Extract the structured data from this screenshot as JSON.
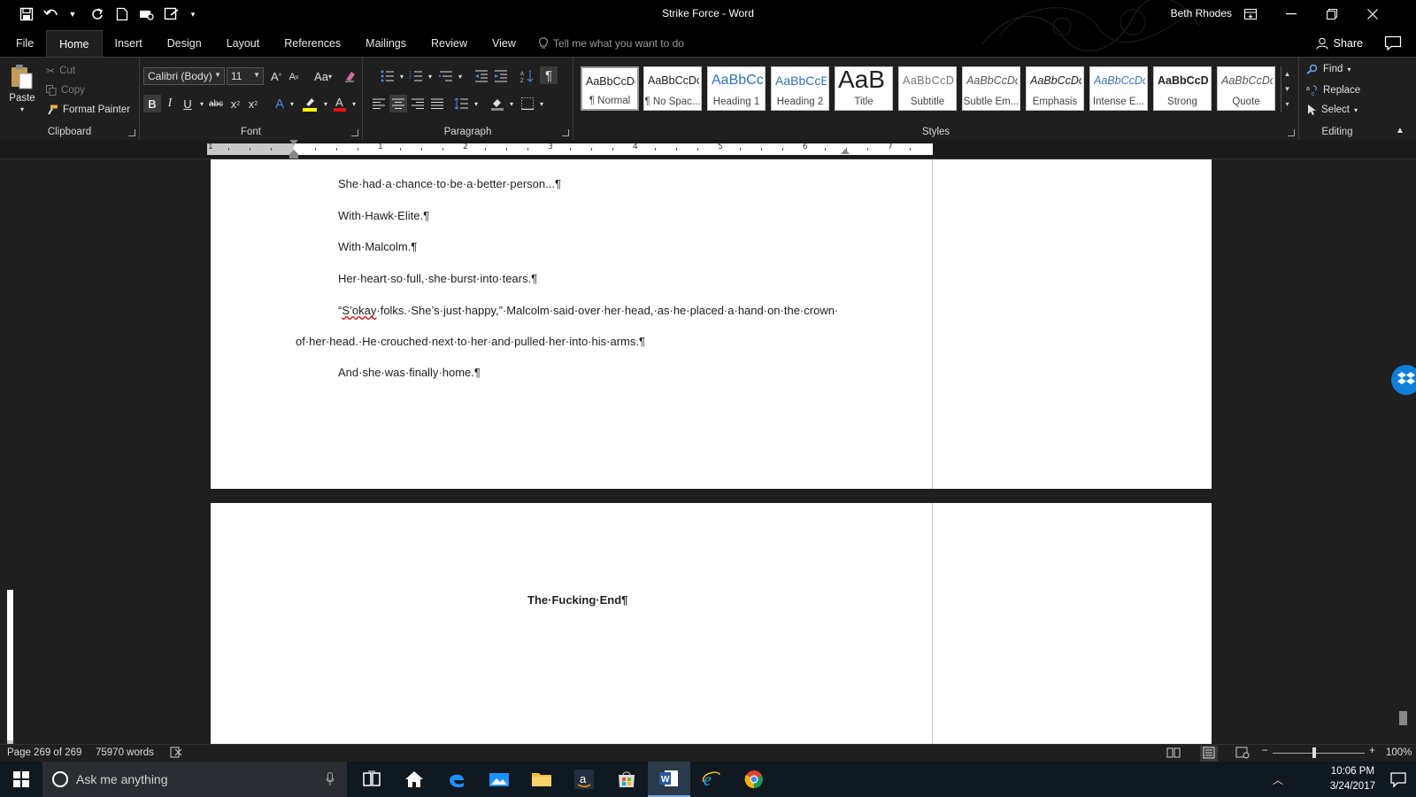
{
  "window": {
    "title": "Strike Force  -  Word",
    "user": "Beth Rhodes"
  },
  "tabs": [
    "File",
    "Home",
    "Insert",
    "Design",
    "Layout",
    "References",
    "Mailings",
    "Review",
    "View"
  ],
  "tell_me": "Tell me what you want to do",
  "share": "Share",
  "clipboard": {
    "paste": "Paste",
    "cut": "Cut",
    "copy": "Copy",
    "format_painter": "Format Painter",
    "label": "Clipboard"
  },
  "font": {
    "name": "Calibri (Body)",
    "size": "11",
    "change_case": "Aa",
    "label": "Font"
  },
  "paragraph": {
    "label": "Paragraph"
  },
  "styles": {
    "label": "Styles",
    "items": [
      {
        "preview": "AaBbCcDc",
        "name": "¶ Normal"
      },
      {
        "preview": "AaBbCcDc",
        "name": "¶ No Spac..."
      },
      {
        "preview": "AaBbCc",
        "name": "Heading 1"
      },
      {
        "preview": "AaBbCcE",
        "name": "Heading 2"
      },
      {
        "preview": "AaB",
        "name": "Title"
      },
      {
        "preview": "AaBbCcD",
        "name": "Subtitle"
      },
      {
        "preview": "AaBbCcDc",
        "name": "Subtle Em..."
      },
      {
        "preview": "AaBbCcDc",
        "name": "Emphasis"
      },
      {
        "preview": "AaBbCcDc",
        "name": "Intense E..."
      },
      {
        "preview": "AaBbCcDc",
        "name": "Strong"
      },
      {
        "preview": "AaBbCcDc",
        "name": "Quote"
      }
    ]
  },
  "editing": {
    "find": "Find",
    "replace": "Replace",
    "select": "Select",
    "label": "Editing"
  },
  "ruler_numbers": [
    "1",
    "1",
    "2",
    "3",
    "4",
    "5",
    "6",
    "7"
  ],
  "document": {
    "page1_lines": [
      "She·had·a·chance·to·be·a·better·person...¶",
      "With·Hawk·Elite.¶",
      "With·Malcolm.¶",
      "Her·heart·so·full,·she·burst·into·tears.¶"
    ],
    "quote_start": "“",
    "quote_misspelled": "S’okay",
    "quote_rest": "·folks.·She’s·just·happy,”·Malcolm·said·over·her·head,·as·he·placed·a·hand·on·the·crown·",
    "quote_line2": "of·her·head.·He·crouched·next·to·her·and·pulled·her·into·his·arms.¶",
    "last_line": "And·she·was·finally·home.¶",
    "page2_text": "The·Fucking·End¶"
  },
  "status": {
    "page": "Page 269 of 269",
    "words": "75970 words",
    "zoom": "100%"
  },
  "taskbar": {
    "search_placeholder": "Ask me anything",
    "time": "10:06 PM",
    "date": "3/24/2017"
  },
  "colors": {
    "dark_bg": "#1f1f1f",
    "title_bg": "#000000",
    "taskbar_bg": "#101820",
    "word_blue": "#2b579a",
    "dropbox_blue": "#0d7fd8"
  }
}
